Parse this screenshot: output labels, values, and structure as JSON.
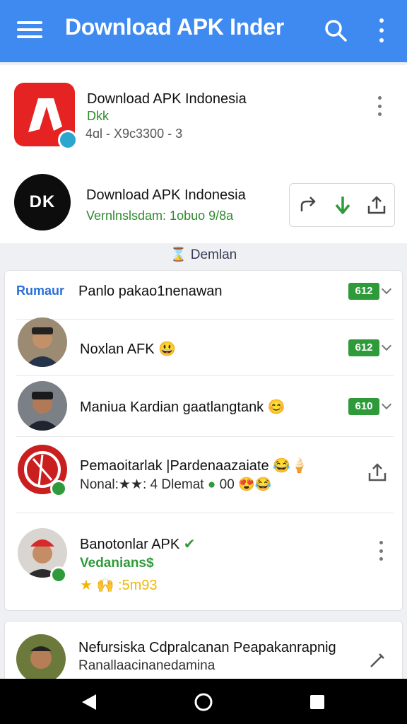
{
  "appbar": {
    "title": "Download APK Inder",
    "menu_icon": "hamburger-menu-icon",
    "search_icon": "search-icon",
    "more_icon": "more-vert-icon",
    "color": "#3f8af0"
  },
  "apps": [
    {
      "title": "Download APK Indonesia",
      "subtitle": "Dkk",
      "meta": "4ɑl - X9c3300 - 3",
      "icon": "red-app-icon",
      "icon_color": "#e52323"
    },
    {
      "title": "Download APK Indonesia",
      "subtitle": "Vernlnslsdam: 1obuo 9/8a",
      "logo_text": "DK",
      "icon": "dk-logo-icon"
    }
  ],
  "actions": {
    "share_icon": "share-arrow-icon",
    "download_icon": "download-arrow-icon",
    "upload_icon": "upload-icon"
  },
  "section": {
    "label": "Demlan",
    "icon": "people-icon"
  },
  "list": {
    "header_label": "Rumaur",
    "header_title": "Panlo pakao1nenawan",
    "header_badge": "612",
    "items": [
      {
        "title": "Noxlan AFK",
        "emoji": "😃",
        "badge": "612"
      },
      {
        "title": "Maniua Kardian gaatlangtank",
        "emoji": "😊",
        "badge": "610"
      },
      {
        "title": "Pemaoitarlak |Pardenaazaiate",
        "emoji": "😂🍦",
        "sub": "Nonal:★★: 4 Dlemat",
        "sub_tail": "00"
      },
      {
        "title": "Banotonlar APK",
        "sub": "Vedanians$",
        "rating": "★  🙌 :5m93"
      }
    ]
  },
  "bottom_item": {
    "title": "Nefursiska Cdpralcanan Peapakanrapnig",
    "sub": "Ranallaacinanedamina"
  },
  "navbar": {
    "back_icon": "back-triangle-icon",
    "home_icon": "home-circle-icon",
    "recents_icon": "recents-square-icon"
  }
}
